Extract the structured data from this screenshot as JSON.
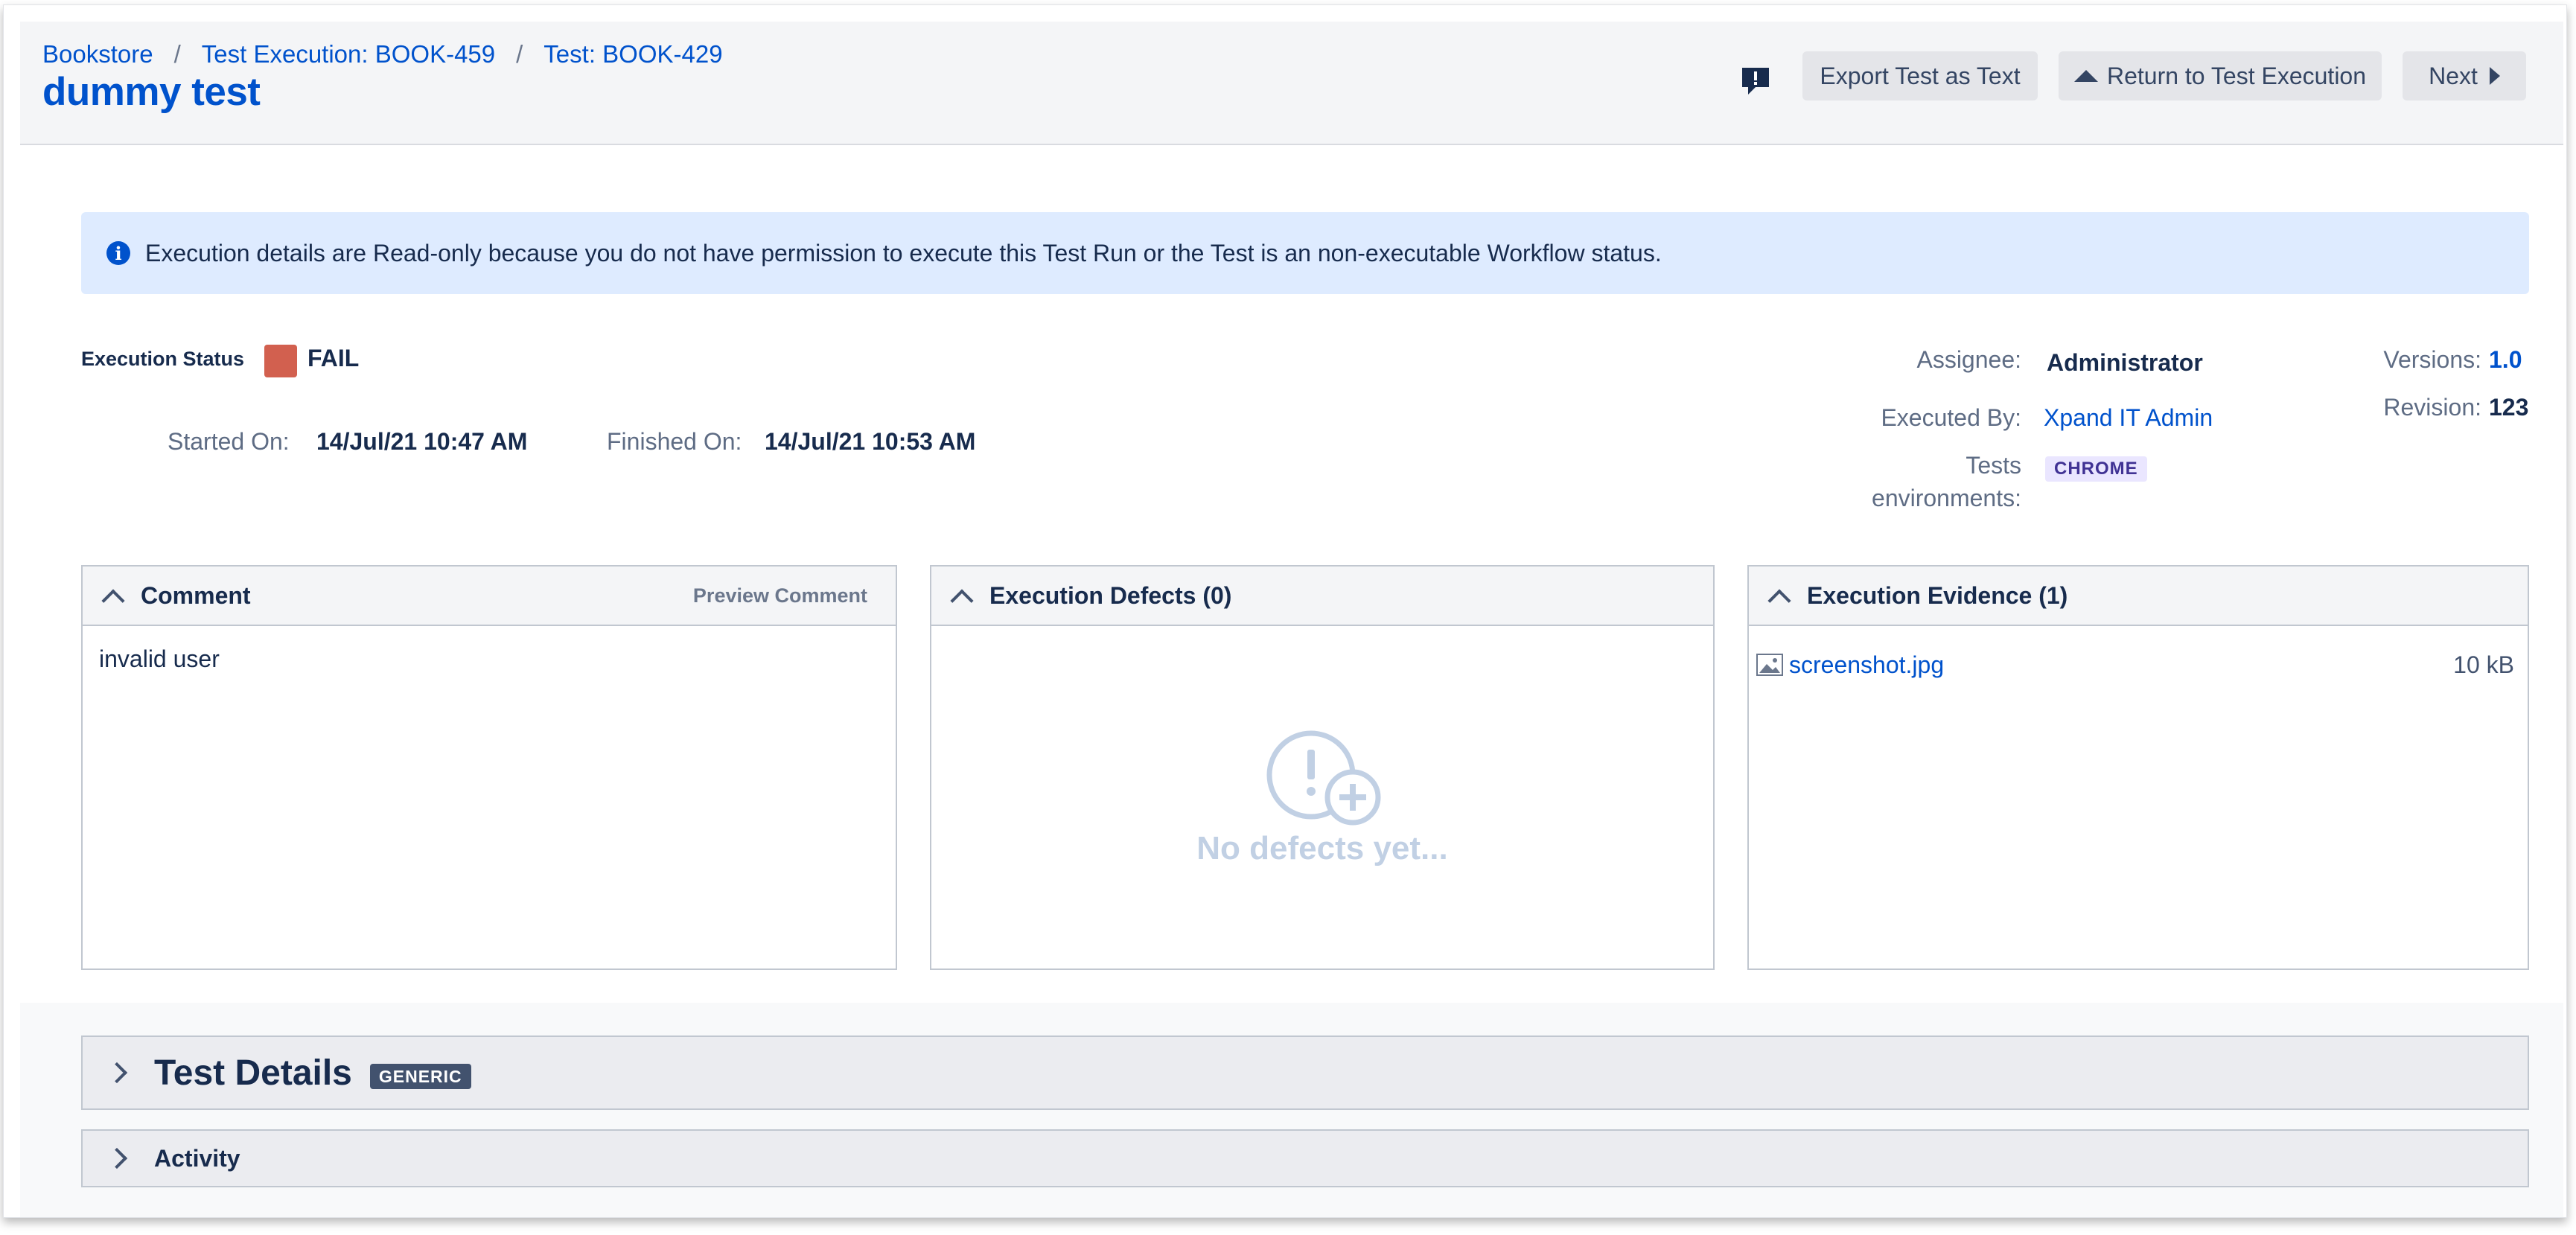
{
  "breadcrumb": [
    "Bookstore",
    "Test Execution: BOOK-459",
    "Test: BOOK-429"
  ],
  "breadcrumb_separator": "/",
  "page_title": "dummy test",
  "header_buttons": {
    "export": "Export Test as Text",
    "return": "Return to Test Execution",
    "next": "Next"
  },
  "info_banner": "Execution details are Read-only because you do not have permission to execute this Test Run or the Test is an non-executable Workflow status.",
  "execution": {
    "status_label": "Execution Status",
    "status": "FAIL",
    "status_color": "#d2604f",
    "started_label": "Started On:",
    "started": "14/Jul/21 10:47 AM",
    "finished_label": "Finished On:",
    "finished": "14/Jul/21 10:53 AM"
  },
  "people": {
    "assignee_label": "Assignee:",
    "assignee": "Administrator",
    "executed_by_label": "Executed By:",
    "executed_by": "Xpand IT Admin",
    "environments_label_1": "Tests",
    "environments_label_2": "environments:",
    "environment": "CHROME"
  },
  "versions": {
    "versions_label": "Versions:",
    "versions": "1.0",
    "revision_label": "Revision:",
    "revision": "123"
  },
  "comment_panel": {
    "title": "Comment",
    "preview": "Preview Comment",
    "body": "invalid user"
  },
  "defects_panel": {
    "title": "Execution Defects (0)",
    "empty": "No defects yet..."
  },
  "evidence_panel": {
    "title": "Execution Evidence (1)",
    "file_name": "screenshot.jpg",
    "file_size": "10 kB"
  },
  "test_details": {
    "title": "Test Details",
    "badge": "GENERIC"
  },
  "activity": {
    "title": "Activity"
  },
  "colors": {
    "link": "#0052cc",
    "banner": "#deebff",
    "text": "#172b4d"
  }
}
